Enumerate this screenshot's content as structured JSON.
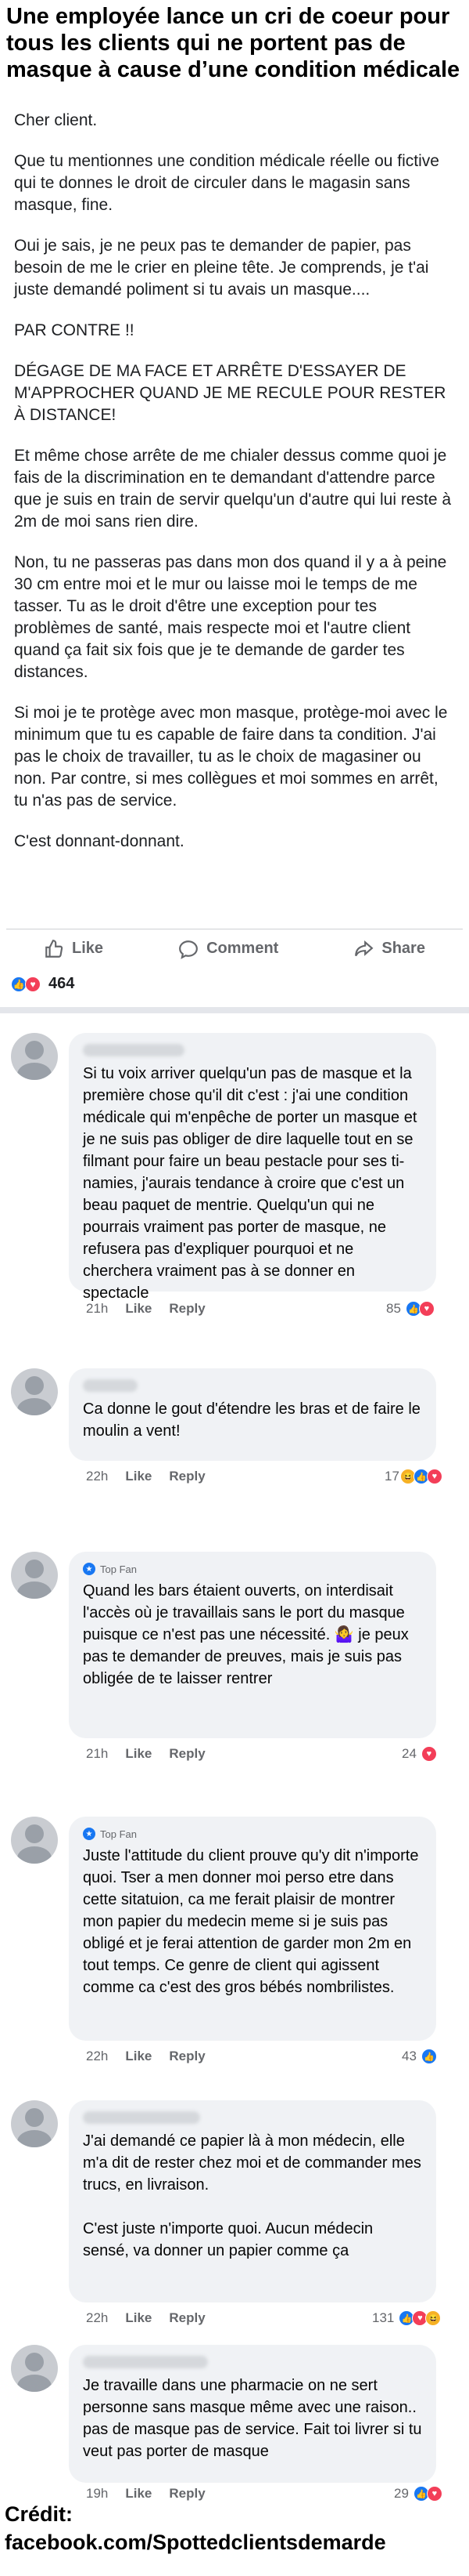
{
  "headline": "Une employée lance un cri de coeur pour tous les clients qui ne portent pas de masque à cause d’une condition médicale",
  "post": {
    "paragraphs": [
      "Cher client.",
      "Que tu mentionnes une condition médicale réelle ou fictive qui te donnes le droit de circuler dans le magasin sans masque, fine.",
      "Oui je sais, je ne peux pas te demander de papier, pas besoin de me le crier en pleine tête. Je comprends, je t'ai juste demandé poliment si tu avais un masque....",
      "PAR CONTRE !!",
      "DÉGAGE DE MA FACE ET ARRÊTE D'ESSAYER DE M'APPROCHER QUAND JE ME RECULE POUR RESTER À DISTANCE!",
      "Et même chose arrête de me chialer dessus comme quoi je fais de la discrimination en te demandant d'attendre parce que je suis en train de servir quelqu'un d'autre qui lui reste à 2m de moi sans rien dire.",
      "Non, tu ne passeras pas dans mon dos quand il y a à peine 30 cm entre moi et le mur ou laisse moi le temps de me tasser. Tu as le droit d'être une exception pour tes problèmes de santé, mais respecte moi et l'autre client quand ça fait six fois que je te demande de garder tes distances.",
      "Si moi je te protège avec mon masque, protège-moi avec le minimum que tu es capable de faire dans ta condition. J'ai pas le choix de travailler, tu as le choix de magasiner ou non. Par contre, si mes collègues et moi sommes en arrêt, tu n'as pas de service.",
      "C'est donnant-donnant."
    ]
  },
  "actions": {
    "like": "Like",
    "comment": "Comment",
    "share": "Share"
  },
  "reaction_total": "464",
  "comments": [
    {
      "top_fan": "",
      "text": "Si tu voix arriver quelqu'un pas de masque et la première chose qu'il dit c'est : j'ai une condition médicale qui m'enpêche de porter un masque et je ne suis pas obliger de dire laquelle tout en se filmant pour faire un beau pestacle pour ses ti-namies, j'aurais tendance à croire que c'est un beau paquet de mentrie. Quelqu'un qui ne pourrais vraiment pas porter de masque, ne refusera pas d'expliquer pourquoi et ne cherchera vraiment pas à se donner en spectacle",
      "time": "21h",
      "like": "Like",
      "reply": "Reply",
      "count": "85"
    },
    {
      "top_fan": "",
      "text": "Ca donne le gout d'étendre les bras et de faire le moulin a vent!",
      "time": "22h",
      "like": "Like",
      "reply": "Reply",
      "count": "17"
    },
    {
      "top_fan": "Top Fan",
      "text": "Quand les bars étaient ouverts, on interdisait l'accès où je travaillais sans le port du masque puisque ce n'est pas une nécessité. 🤷‍♀️ je peux pas te demander de preuves, mais je suis pas obligée de te laisser rentrer",
      "time": "21h",
      "like": "Like",
      "reply": "Reply",
      "count": "24"
    },
    {
      "top_fan": "Top Fan",
      "text": "Juste l'attitude du client prouve qu'y dit n'importe quoi. Tser a men donner moi perso etre dans cette sitatuion, ca me ferait plaisir de montrer mon papier du medecin meme si je suis pas obligé et je ferai attention de garder mon 2m en tout temps. Ce genre de client qui agissent comme ca c'est des gros bébés nombrilistes.",
      "time": "22h",
      "like": "Like",
      "reply": "Reply",
      "count": "43"
    },
    {
      "top_fan": "",
      "text": "J'ai demandé ce papier là à mon médecin, elle m'a dit de rester chez moi et de commander mes trucs, en livraison.\n\nC'est juste n'importe quoi. Aucun médecin sensé, va donner un papier comme ça",
      "time": "22h",
      "like": "Like",
      "reply": "Reply",
      "count": "131"
    },
    {
      "top_fan": "",
      "text": "Je travaille dans une pharmacie on ne sert personne sans masque même avec une raison.. pas de masque pas de service. Fait toi livrer si tu veut pas porter de masque",
      "time": "19h",
      "like": "Like",
      "reply": "Reply",
      "count": "29"
    }
  ],
  "credit": {
    "line1": "Crédit:",
    "line2": "facebook.com/Spottedclientsdemarde"
  },
  "colors": {
    "like_blue": "#1877f2",
    "love_red": "#f33e58",
    "haha_yellow": "#f7b125",
    "bubble_gray": "#f0f2f5"
  },
  "icons": [
    "thumbs-up-icon",
    "comment-icon",
    "share-icon",
    "like-reaction-icon",
    "love-reaction-icon",
    "haha-reaction-icon",
    "top-fan-badge-icon"
  ]
}
